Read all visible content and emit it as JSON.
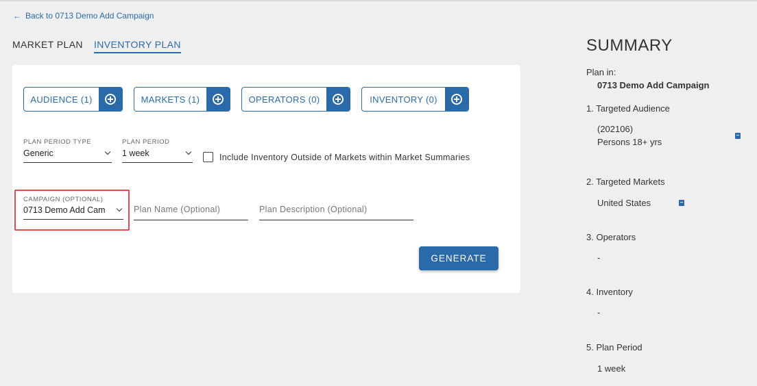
{
  "back_link": {
    "arrow": "←",
    "label": "Back to 0713 Demo Add Campaign"
  },
  "tabs": [
    {
      "label": "MARKET PLAN",
      "active": false
    },
    {
      "label": "INVENTORY PLAN",
      "active": true
    }
  ],
  "pills": [
    {
      "label": "AUDIENCE (1)"
    },
    {
      "label": "MARKETS (1)"
    },
    {
      "label": "OPERATORS (0)"
    },
    {
      "label": "INVENTORY (0)"
    }
  ],
  "plan_period_type": {
    "label": "PLAN PERIOD TYPE",
    "value": "Generic"
  },
  "plan_period": {
    "label": "PLAN PERIOD",
    "value": "1 week"
  },
  "include_outside_checkbox": {
    "label": "Include Inventory Outside of Markets within Market Summaries",
    "checked": false
  },
  "campaign": {
    "label": "CAMPAIGN (OPTIONAL)",
    "value": "0713 Demo Add Cam"
  },
  "plan_name": {
    "placeholder": "Plan Name (Optional)",
    "value": ""
  },
  "plan_description": {
    "placeholder": "Plan Description (Optional)",
    "value": ""
  },
  "generate_button": {
    "label": "GENERATE"
  },
  "summary": {
    "title": "SUMMARY",
    "plan_in_label": "Plan in:",
    "plan_in_value": "0713 Demo Add Campaign",
    "audience_heading": "1. Targeted Audience",
    "audience_code": "(202106)",
    "audience_name": "Persons 18+ yrs",
    "markets_heading": "2. Targeted Markets",
    "markets_value": "United States",
    "operators_heading": "3. Operators",
    "operators_value": "-",
    "inventory_heading": "4. Inventory",
    "inventory_value": "-",
    "plan_period_heading": "5. Plan Period",
    "plan_period_value": "1 week"
  },
  "colors": {
    "accent": "#2a6aa8",
    "background": "#efefef",
    "card": "#ffffff",
    "highlight": "#e24b4b"
  }
}
